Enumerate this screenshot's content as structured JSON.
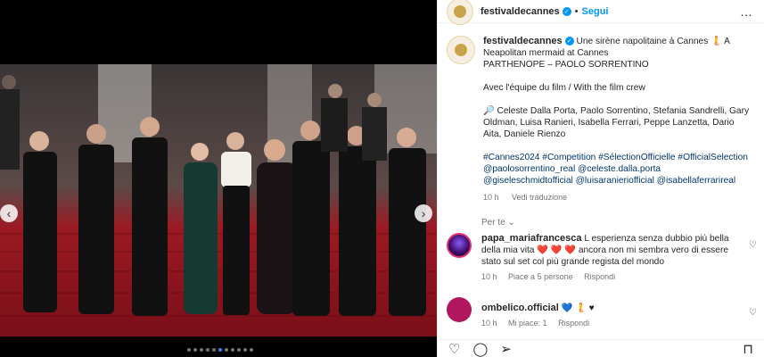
{
  "post": {
    "username": "festivaldecannes",
    "follow_label": "Segui",
    "separator": "•",
    "more_label": "…"
  },
  "caption": {
    "line1": "Une sirène napolitaine à Cannes 🧜 A Neapolitan mermaid at Cannes",
    "line2": "PARTHENOPE – PAOLO SORRENTINO",
    "line3": "Avec l'équipe du film / With the film crew",
    "line4": "🔎 Celeste Dalla Porta, Paolo Sorrentino, Stefania Sandrelli, Gary Oldman, Luisa Ranieri, Isabella Ferrari, Peppe Lanzetta, Dario Aita, Daniele Rienzo",
    "tags": "#Cannes2024 #Competition #SélectionOfficielle #OfficialSelection @paolosorrentino_real @celeste.dalla.porta @giseleschmidtofficial @luisaranieriofficial @isabellaferrarireal",
    "time": "10 h",
    "translate": "Vedi traduzione"
  },
  "comments_header": "Per te",
  "comments": [
    {
      "username": "papa_mariafrancesca",
      "text": "L esperienza senza dubbio più bella della mia vita ❤️ ❤️ ❤️ ancora non mi sembra vero di essere stato sul set col più grande regista del mondo",
      "time": "10 h",
      "likes": "Piace a 5 persone",
      "reply": "Rispondi"
    },
    {
      "username": "ombelico.official",
      "text": "💙 🧜 ♥",
      "time": "10 h",
      "likes": "Mi piace: 1",
      "reply": "Rispondi"
    }
  ],
  "icons": {
    "heart": "heart-icon",
    "comment": "comment-icon",
    "share": "share-icon",
    "save": "bookmark-icon"
  },
  "colors": {
    "accent": "#0095f6",
    "hashtag": "#00376b",
    "muted": "#737373"
  }
}
